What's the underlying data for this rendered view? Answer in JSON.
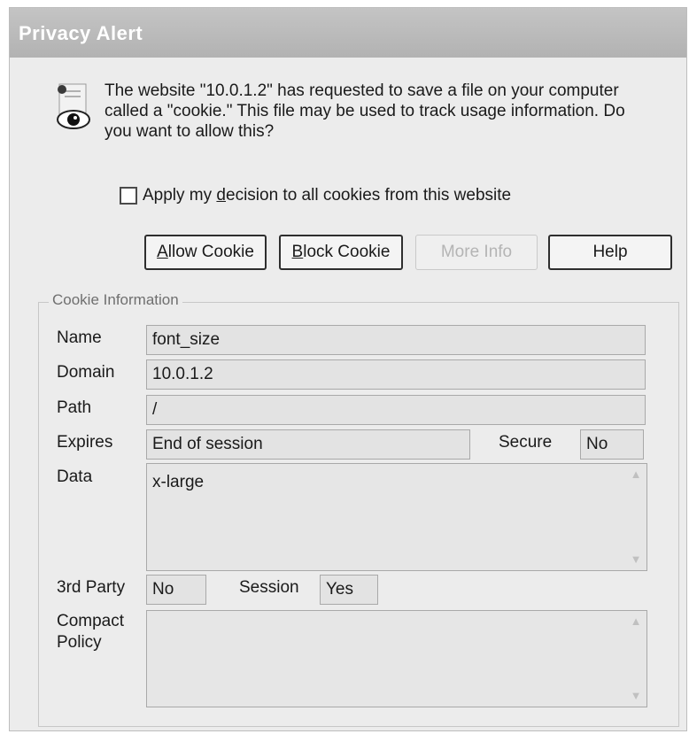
{
  "window": {
    "title": "Privacy Alert"
  },
  "message": {
    "text": "The website \"10.0.1.2\" has requested to save a file on your computer called a \"cookie.\"  This file may be used to track usage information. Do you want to allow this?"
  },
  "apply_all": {
    "label_pre": "Apply my ",
    "label_accel": "d",
    "label_post": "ecision to all cookies from this website",
    "checked": false
  },
  "buttons": {
    "allow": {
      "accel": "A",
      "rest": "llow Cookie"
    },
    "block": {
      "accel": "B",
      "rest": "lock Cookie"
    },
    "more_info": {
      "label": "More Info"
    },
    "help": {
      "label": "Help"
    }
  },
  "cookie_info": {
    "legend": "Cookie Information",
    "name_label": "Name",
    "name_value": "font_size",
    "domain_label": "Domain",
    "domain_value": "10.0.1.2",
    "path_label": "Path",
    "path_value": "/",
    "expires_label": "Expires",
    "expires_value": "End of session",
    "secure_label": "Secure",
    "secure_value": "No",
    "data_label": "Data",
    "data_value": "x-large",
    "third_party_label": "3rd Party",
    "third_party_value": "No",
    "session_label": "Session",
    "session_value": "Yes",
    "compact_policy_label_1": "Compact",
    "compact_policy_label_2": "Policy",
    "compact_policy_value": ""
  },
  "icons": {
    "dialog_icon": "privacy-eye-icon",
    "scroll_up": "scroll-up-arrow-icon",
    "scroll_down": "scroll-down-arrow-icon"
  }
}
